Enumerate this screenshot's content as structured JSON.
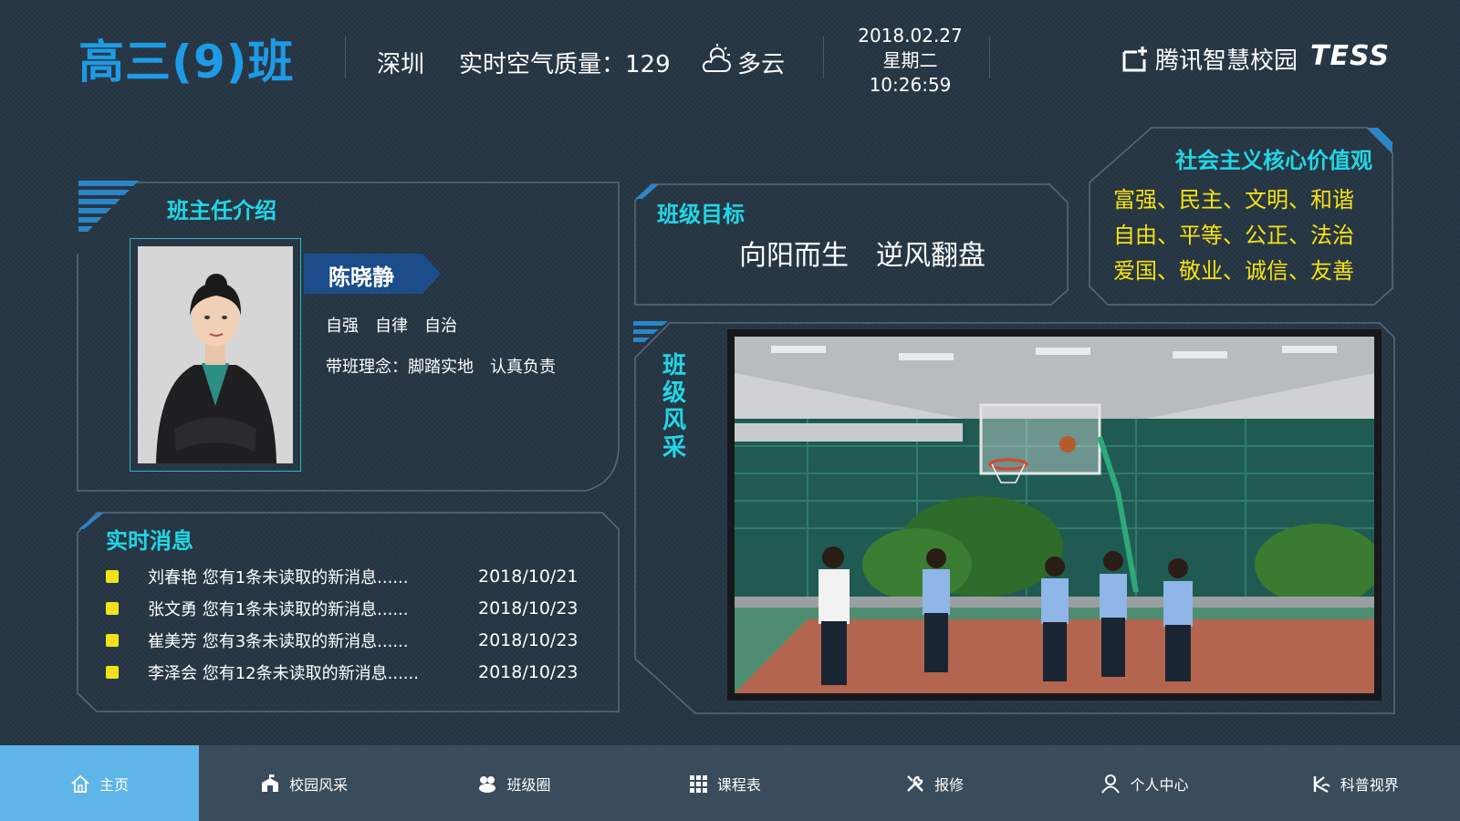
{
  "header": {
    "class_name": "高三(9)班",
    "city": "深圳",
    "air_quality": "实时空气质量：129",
    "weather": "多云",
    "date": "2018.02.27",
    "weekday": "星期二",
    "time": "10:26:59",
    "brand": "腾讯智慧校园",
    "brand2": "TESS"
  },
  "teacher": {
    "title": "班主任介绍",
    "name": "陈晓静",
    "motto": "自强　自律　自治",
    "philosophy": "带班理念：脚踏实地　认真负责"
  },
  "goal": {
    "title": "班级目标",
    "text": "向阳而生　逆风翻盘"
  },
  "values": {
    "title": "社会主义核心价值观",
    "lines": [
      "富强、民主、文明、和谐",
      "自由、平等、公正、法治",
      "爱国、敬业、诚信、友善"
    ]
  },
  "news": {
    "title": "实时消息",
    "items": [
      {
        "text": "刘春艳 您有1条未读取的新消息......",
        "date": "2018/10/21"
      },
      {
        "text": "张文勇 您有1条未读取的新消息......",
        "date": "2018/10/23"
      },
      {
        "text": "崔美芳 您有3条未读取的新消息......",
        "date": "2018/10/23"
      },
      {
        "text": "李泽会 您有12条未读取的新消息......",
        "date": "2018/10/23"
      }
    ]
  },
  "showcase": {
    "title": "班级风采"
  },
  "nav": [
    {
      "label": "主页",
      "icon": "home-icon",
      "active": true
    },
    {
      "label": "校园风采",
      "icon": "school-icon"
    },
    {
      "label": "班级圈",
      "icon": "class-circle-icon"
    },
    {
      "label": "课程表",
      "icon": "grid-icon"
    },
    {
      "label": "报修",
      "icon": "tools-icon"
    },
    {
      "label": "个人中心",
      "icon": "user-icon"
    },
    {
      "label": "科普视界",
      "icon": "science-icon"
    }
  ],
  "colors": {
    "accent": "#21d7e6",
    "title_blue": "#1e9be6",
    "values_yellow": "#f5e213",
    "nav_active": "#5fb5e8"
  }
}
